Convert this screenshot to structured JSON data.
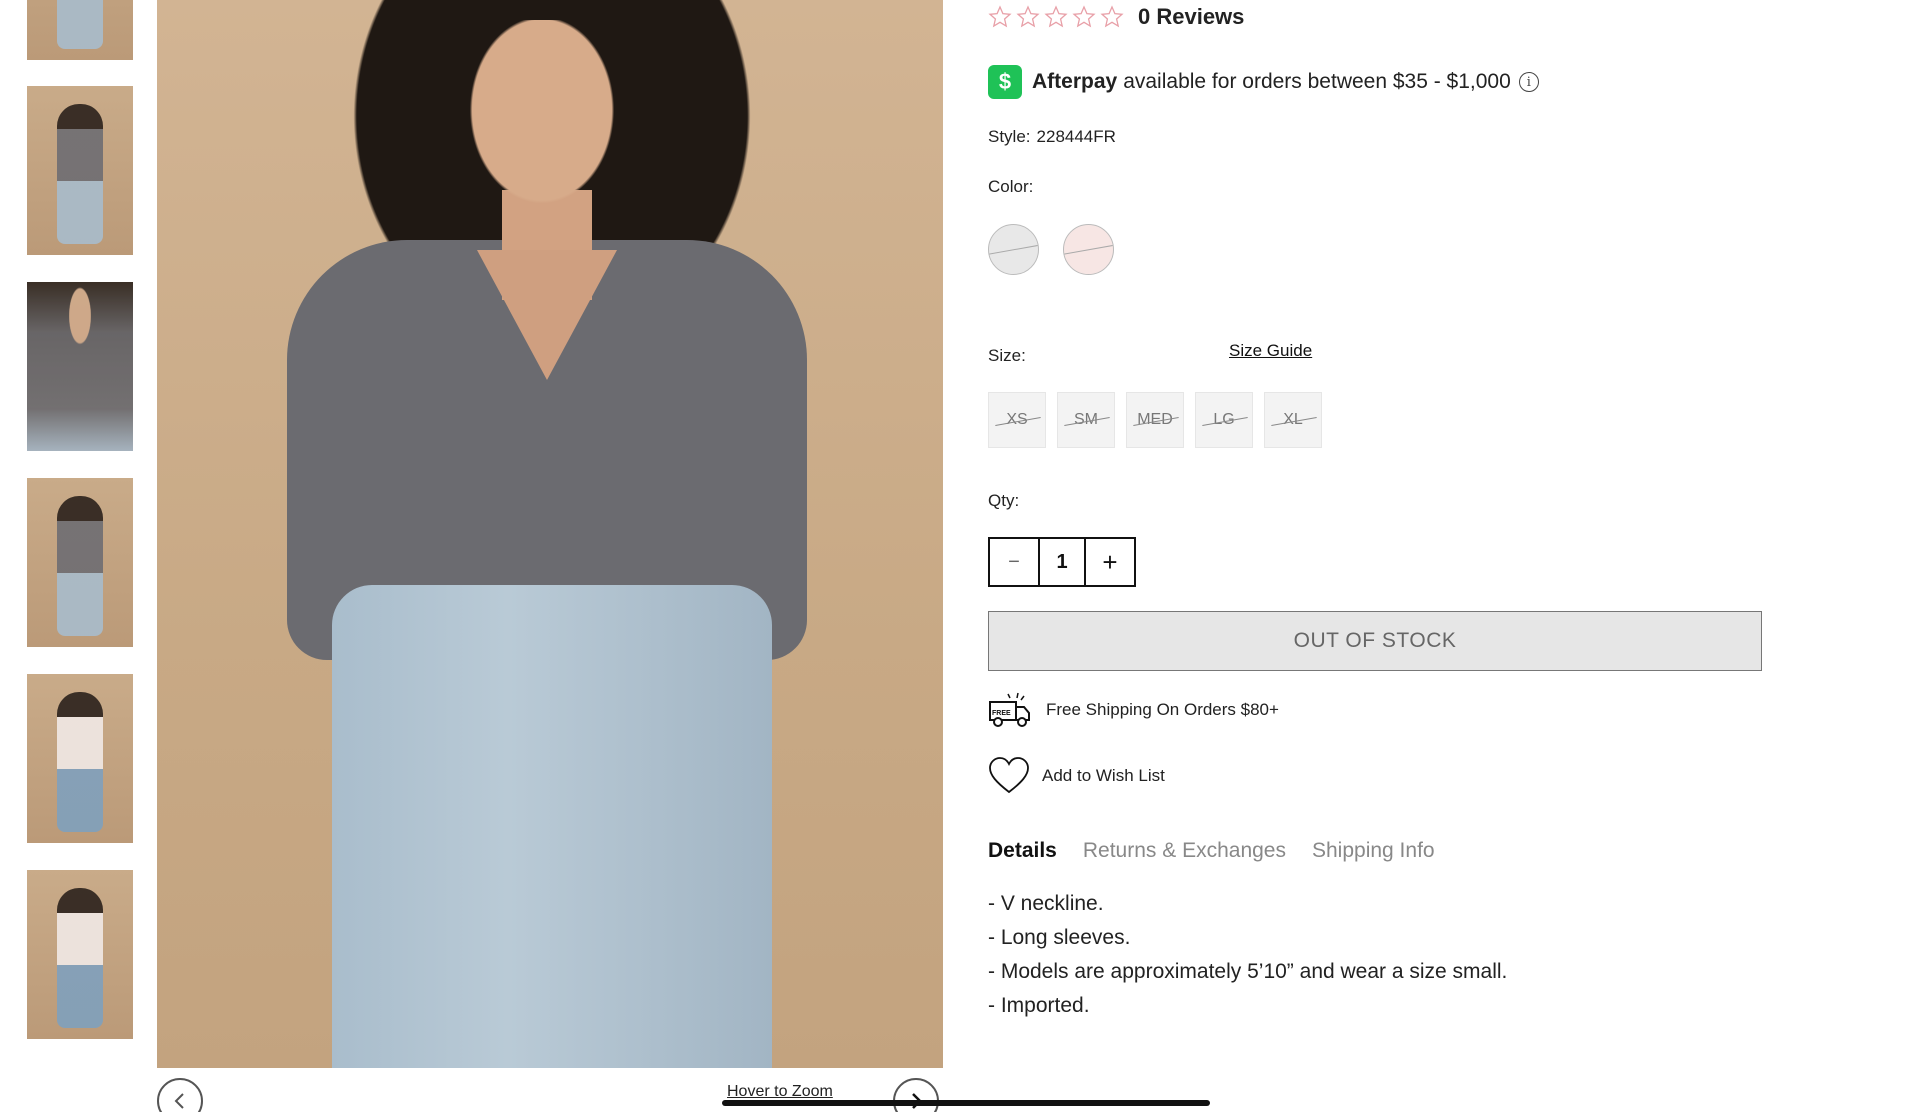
{
  "gallery": {
    "thumbnails": [
      {
        "alt": "thumbnail-1"
      },
      {
        "alt": "thumbnail-2"
      },
      {
        "alt": "thumbnail-3"
      },
      {
        "alt": "thumbnail-4"
      },
      {
        "alt": "thumbnail-5"
      },
      {
        "alt": "thumbnail-6"
      }
    ],
    "hover_zoom": "Hover to Zoom",
    "prev_icon": "chevron-left-icon",
    "next_icon": "chevron-right-icon"
  },
  "product": {
    "rating": 0,
    "reviews_label": "0 Reviews",
    "afterpay": {
      "logo": "$",
      "brand": "Afterpay",
      "text": "available for orders between $35 - $1,000",
      "info_icon": "i"
    },
    "style_label": "Style:",
    "style_value": "228444FR",
    "color_label": "Color:",
    "colors": [
      "#e8e8e8",
      "#f7e6e4"
    ],
    "size_label": "Size:",
    "size_guide": "Size Guide",
    "sizes": [
      "XS",
      "SM",
      "MED",
      "LG",
      "XL"
    ],
    "qty_label": "Qty:",
    "qty_minus": "−",
    "qty_value": "1",
    "qty_plus": "+",
    "out_of_stock": "OUT OF STOCK",
    "shipping_text": "Free Shipping On Orders $80+",
    "shipping_badge": "FREE",
    "wishlist_text": "Add to Wish List",
    "tabs": [
      "Details",
      "Returns & Exchanges",
      "Shipping Info"
    ],
    "details": [
      "- V neckline.",
      "- Long sleeves.",
      "- Models are approximately 5’10” and wear a size small.",
      "- Imported."
    ]
  },
  "colors": {
    "afterpay_green": "#1fc257",
    "text": "#222222",
    "muted": "#888888"
  }
}
